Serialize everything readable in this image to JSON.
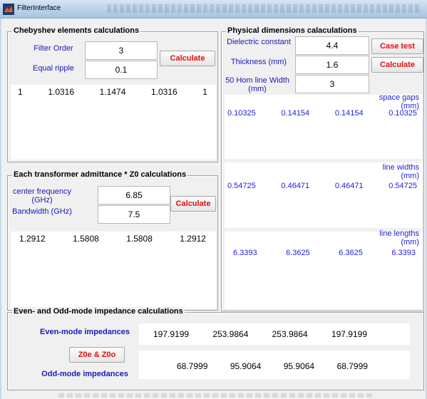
{
  "window": {
    "title": "FilterInterface"
  },
  "chebyshev": {
    "title": "Chebyshev elements calculations",
    "filter_order_label": "Filter Order",
    "filter_order_value": "3",
    "ripple_label": "Equal ripple",
    "ripple_value": "0.1",
    "calculate_label": "Calculate",
    "results": [
      "1",
      "1.0316",
      "1.1474",
      "1.0316",
      "1"
    ]
  },
  "admittance": {
    "title": "Each transformer admittance * Z0 calculations",
    "center_freq_label": "center frequency (GHz)",
    "center_freq_value": "6.85",
    "bandwidth_label": "Bandwidth (GHz)",
    "bandwidth_value": "7.5",
    "calculate_label": "Calculate",
    "results": [
      "1.2912",
      "1.5808",
      "1.5808",
      "1.2912"
    ]
  },
  "physical": {
    "title": "Physical dimensions calaculations",
    "dielectric_label": "Dielectric constant",
    "dielectric_value": "4.4",
    "thickness_label": "Thickness (mm)",
    "thickness_value": "1.6",
    "line_width_label": "50 Hom line Width (mm)",
    "line_width_value": "3",
    "case_test_label": "Case test",
    "calculate_label": "Calculate",
    "space_gaps_label": "space gaps (mm)",
    "space_gaps": [
      "0.10325",
      "0.14154",
      "0.14154",
      "0.10325"
    ],
    "line_widths_label": "line widths (mm)",
    "line_widths": [
      "0.54725",
      "0.46471",
      "0.46471",
      "0.54725"
    ],
    "line_lengths_label": "line lengths (mm)",
    "line_lengths": [
      "6.3393",
      "6.3625",
      "6.3625",
      "6.3393"
    ]
  },
  "impedance": {
    "title": "Even- and Odd-mode impedance calculations",
    "even_label": "Even-mode impedances",
    "odd_label": "Odd-mode impedances",
    "button_label": "Z0e & Z0o",
    "even_values": [
      "197.9199",
      "253.9864",
      "253.9864",
      "197.9199"
    ],
    "odd_values": [
      "68.7999",
      "95.9064",
      "95.9064",
      "68.7999"
    ]
  },
  "colors": {
    "label_blue": "#1a1ab8",
    "value_blue": "#2020d8",
    "button_red": "#e01010"
  }
}
